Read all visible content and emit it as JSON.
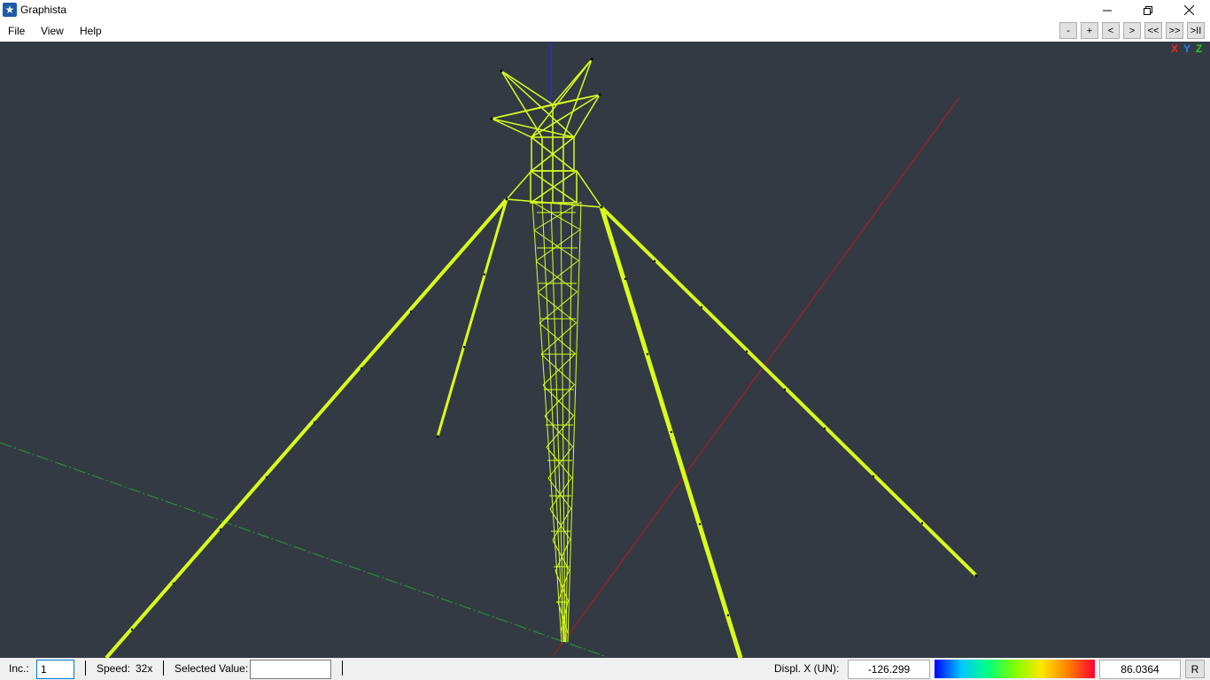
{
  "window": {
    "title": "Graphista",
    "icon": "graphista-star-icon"
  },
  "menu": {
    "items": [
      "File",
      "View",
      "Help"
    ]
  },
  "nav_buttons": [
    "-",
    "+",
    "<",
    ">",
    "<<",
    ">>",
    ">II"
  ],
  "axes_legend": {
    "x": "X",
    "y": "Y",
    "z": "Z",
    "x_color": "#ff2020",
    "y_color": "#2080ff",
    "z_color": "#20d020"
  },
  "viewport": {
    "background": "#343a44",
    "model_color": "#d8ff1c"
  },
  "status": {
    "inc_label": "Inc.:",
    "inc_value": "1",
    "speed_label": "Speed:",
    "speed_value": "32x",
    "selected_label": "Selected Value:",
    "selected_value": "",
    "result_label": "Displ. X (UN):",
    "min_value": "-126.299",
    "max_value": "86.0364",
    "reset_label": "R"
  }
}
